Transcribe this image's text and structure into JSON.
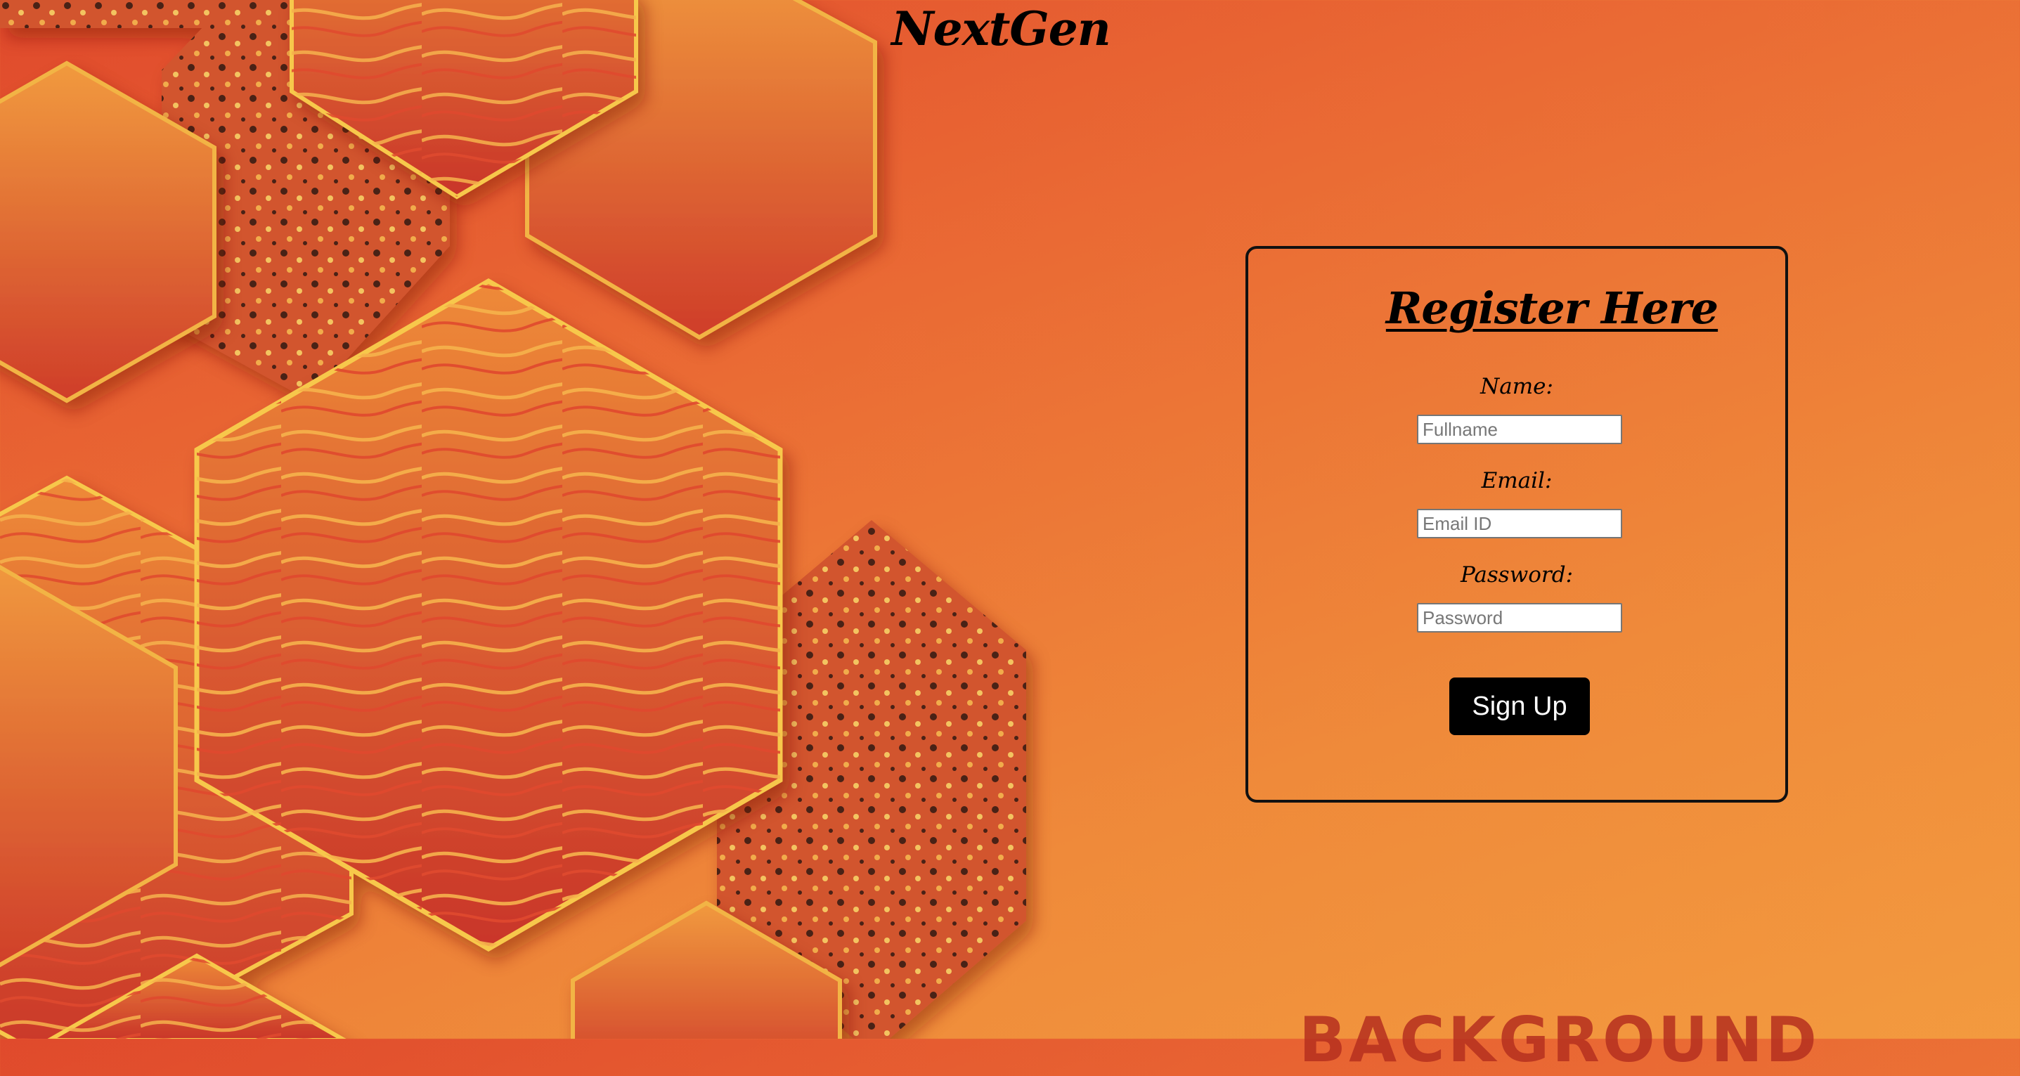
{
  "brand": {
    "name": "NextGen"
  },
  "form": {
    "title": "Register Here",
    "fields": [
      {
        "label": "Name:",
        "placeholder": "Fullname",
        "value": ""
      },
      {
        "label": "Email:",
        "placeholder": "Email ID",
        "value": ""
      },
      {
        "label": "Password:",
        "placeholder": "Password",
        "value": ""
      }
    ],
    "submit_label": "Sign Up"
  },
  "background": {
    "watermark_text": "BACKGROUND"
  },
  "colors": {
    "background_start": "#e04a2c",
    "background_end": "#f39a3f",
    "hexagon_light": "#f19a3e",
    "hexagon_dark": "#cf3d2a",
    "hexagon_edge": "#f7c84b",
    "button": "#000000",
    "card_border": "#111111"
  }
}
